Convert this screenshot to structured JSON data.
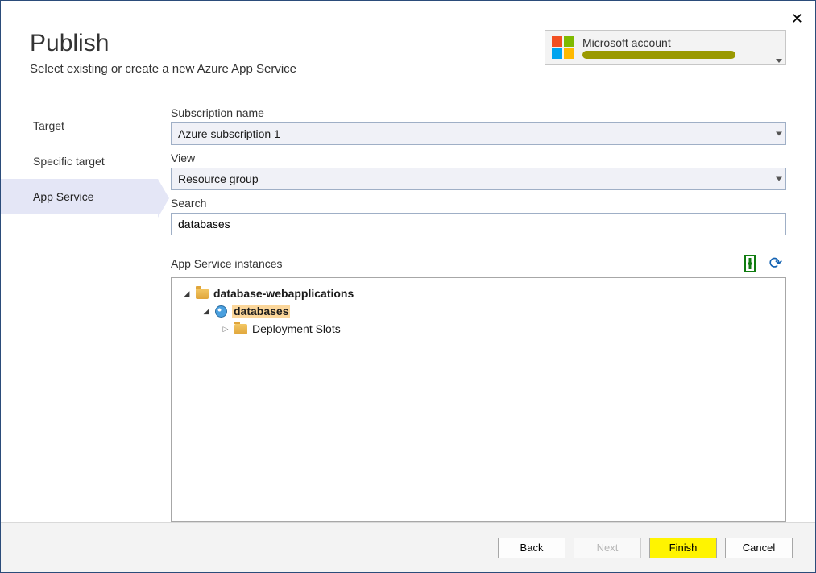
{
  "header": {
    "title": "Publish",
    "subtitle": "Select existing or create a new Azure App Service"
  },
  "account": {
    "label": "Microsoft account",
    "email_redacted": true
  },
  "sidebar": {
    "items": [
      {
        "label": "Target",
        "selected": false
      },
      {
        "label": "Specific target",
        "selected": false
      },
      {
        "label": "App Service",
        "selected": true
      }
    ]
  },
  "fields": {
    "subscription_label": "Subscription name",
    "subscription_value": "Azure subscription 1",
    "view_label": "View",
    "view_value": "Resource group",
    "search_label": "Search",
    "search_value": "databases"
  },
  "instances": {
    "label": "App Service instances",
    "tree": {
      "root": {
        "label": "database-webapplications",
        "type": "folder",
        "expanded": true
      },
      "child": {
        "label": "databases",
        "type": "app",
        "expanded": true,
        "selected": true
      },
      "grandchild": {
        "label": "Deployment Slots",
        "type": "folder",
        "expanded": false
      }
    }
  },
  "buttons": {
    "back": "Back",
    "next": "Next",
    "finish": "Finish",
    "cancel": "Cancel"
  }
}
